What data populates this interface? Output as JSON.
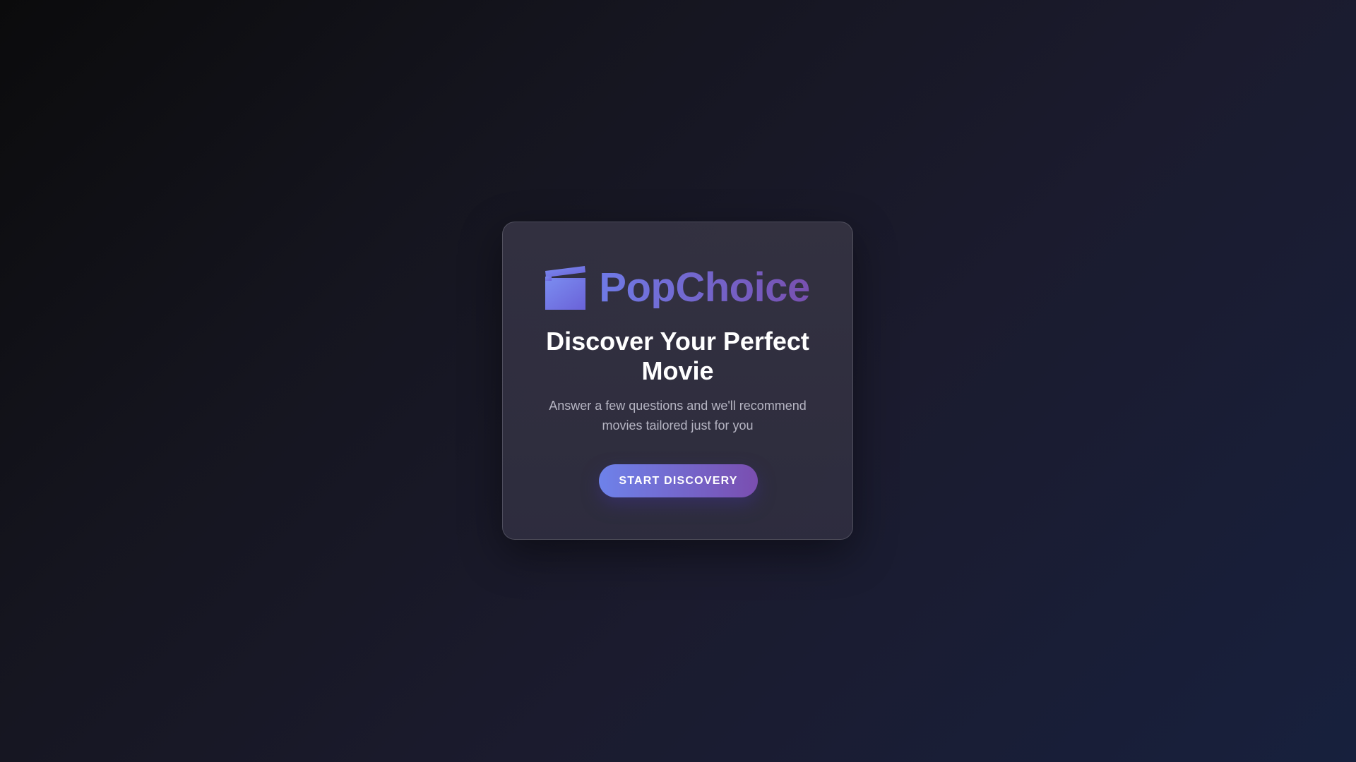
{
  "colors": {
    "accent_start": "#6e82ea",
    "accent_end": "#7a4eb0",
    "headline": "#ffffff",
    "subtitle": "#b6b5c3"
  },
  "brand": {
    "icon": "clapperboard-icon",
    "name": "PopChoice"
  },
  "hero": {
    "headline": "Discover Your Perfect Movie",
    "subtitle": "Answer a few questions and we'll recommend movies tailored just for you"
  },
  "cta": {
    "label": "START DISCOVERY"
  }
}
